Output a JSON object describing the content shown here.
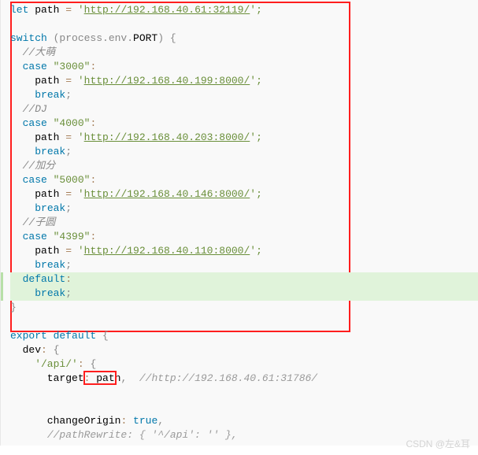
{
  "code": {
    "l01a": "let",
    "l01b": " path ",
    "l01c": "=",
    "l01d": " '",
    "l01e": "http://192.168.40.61:32119/",
    "l01f": "';",
    "l02a": "switch",
    "l02b": " (process.env.",
    "l02c": "PORT",
    "l02d": ") {",
    "c1": "//大萌",
    "l03a": "case",
    "l03b": " \"3000\"",
    "l03c": ":",
    "l04a": "    path ",
    "l04b": "=",
    "l04c": " '",
    "l04d": "http://192.168.40.199:8000/",
    "l04e": "';",
    "brk": "break",
    "semi": ";",
    "c2": "//DJ",
    "l05b": " \"4000\"",
    "l06d": "http://192.168.40.203:8000/",
    "c3": "//加分",
    "l07b": " \"5000\"",
    "l08d": "http://192.168.40.146:8000/",
    "c4": "//子圆",
    "l09b": " \"4399\"",
    "l10d": "http://192.168.40.110:8000/",
    "def": "default",
    "expa": "export",
    "expb": " default",
    "expc": " {",
    "dev": "  dev",
    "colon": ":",
    "brace": " {",
    "api": "    '/api/'",
    "tgt": "      target",
    "pathv": " path",
    "comma": ",",
    "cmturl": "//http://192.168.40.61:31786/",
    "chg": "      changeOrigin",
    "tru": " true",
    "cmtrw": "//pathRewrite: { '^/api': '' },"
  },
  "watermark": "CSDN @左&耳"
}
